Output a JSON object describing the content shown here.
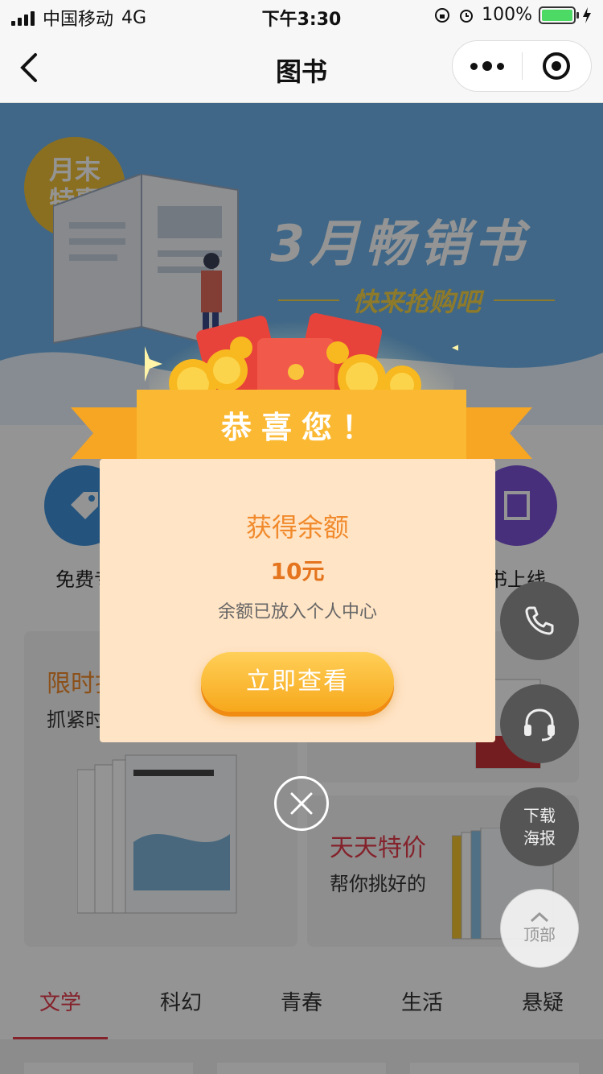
{
  "status_bar": {
    "carrier": "中国移动",
    "network": "4G",
    "time": "下午3:30",
    "battery": "100%",
    "battery_level": 1.0
  },
  "nav": {
    "title": "图书",
    "back_icon": "chevron-left-icon",
    "more_icon": "more-dots-icon",
    "close_icon": "target-circle-icon"
  },
  "banner": {
    "badge_line1": "月末",
    "badge_line2": "特惠",
    "title": "3月畅销书",
    "subtitle": "快来抢购吧"
  },
  "categories": [
    {
      "label": "免费专",
      "color": "#3f8fd8",
      "icon": "tag-icon"
    },
    {
      "label": "",
      "color": "#f0a640",
      "icon": "book-icon"
    },
    {
      "label": "",
      "color": "#e95b66",
      "icon": "star-icon"
    },
    {
      "label": "书上线",
      "color": "#7a52d6",
      "icon": "book-icon"
    }
  ],
  "cards": {
    "left": {
      "title": "限时打",
      "subtitle": "抓紧时"
    },
    "bottom_right": {
      "title": "天天特价",
      "subtitle": "帮你挑好的"
    }
  },
  "tabs": [
    {
      "label": "文学",
      "active": true
    },
    {
      "label": "科幻",
      "active": false
    },
    {
      "label": "青春",
      "active": false
    },
    {
      "label": "生活",
      "active": false
    },
    {
      "label": "悬疑",
      "active": false
    }
  ],
  "side_buttons": {
    "phone_icon": "phone-icon",
    "service_icon": "headset-icon",
    "poster_line1": "下载",
    "poster_line2": "海报",
    "top_label": "顶部"
  },
  "popup": {
    "header": "恭喜您！",
    "title": "获得余额",
    "amount": "10元",
    "description": "余额已放入个人中心",
    "button": "立即查看",
    "close_icon": "close-circle-icon"
  }
}
